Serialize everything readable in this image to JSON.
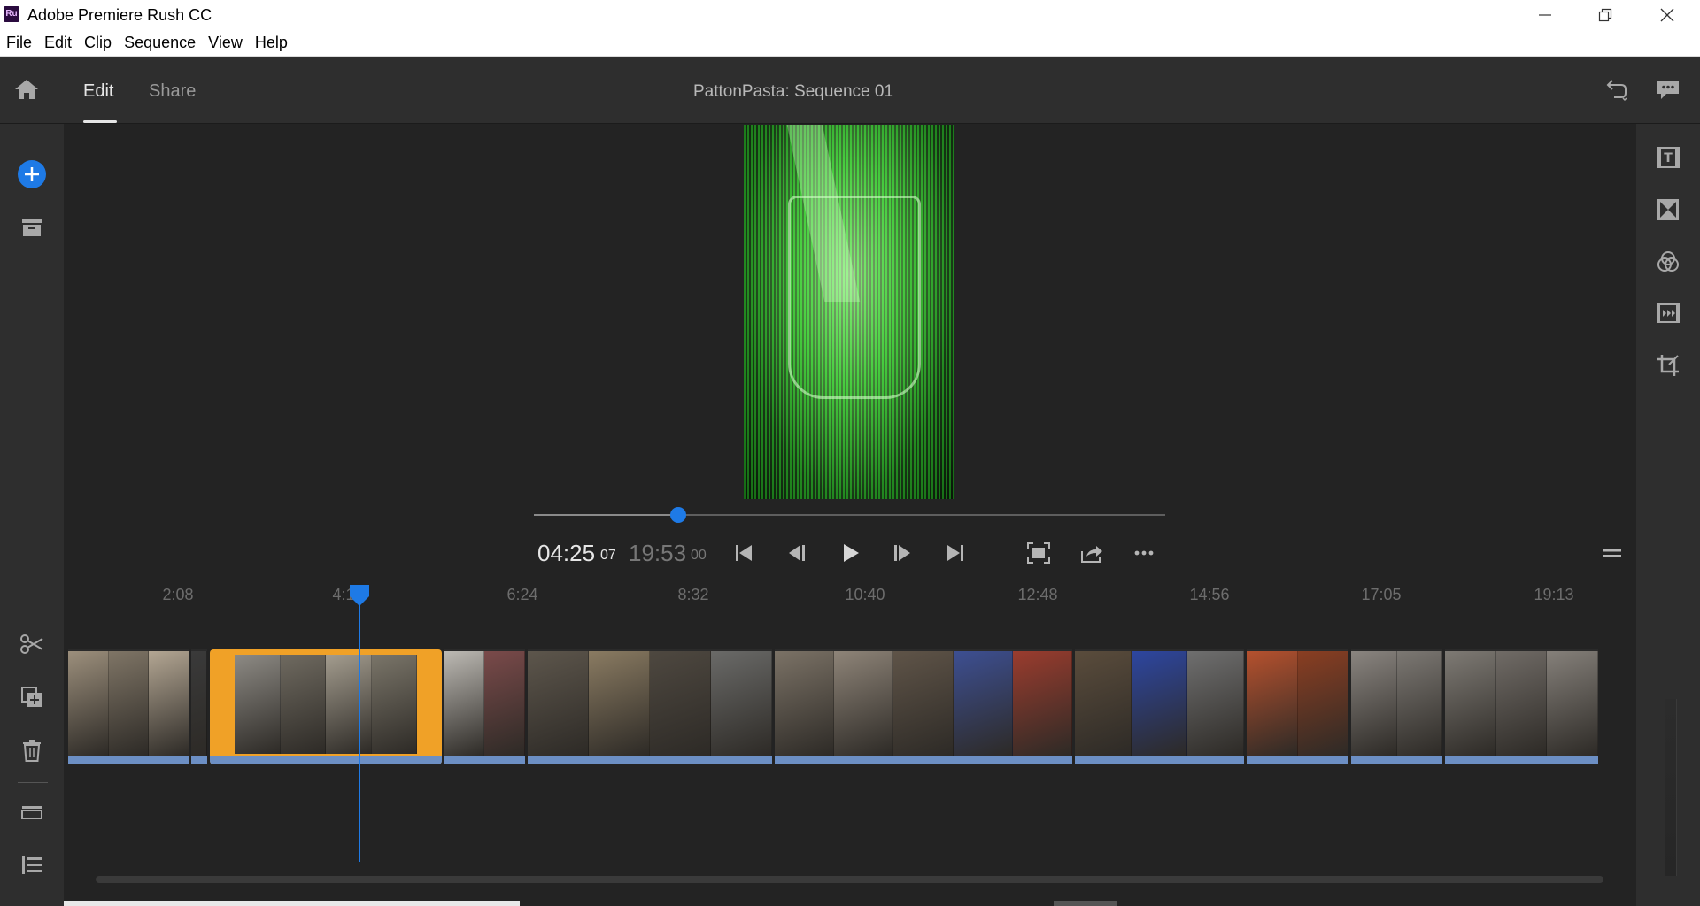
{
  "window": {
    "title": "Adobe Premiere Rush CC",
    "logo_text": "Ru"
  },
  "menu": [
    "File",
    "Edit",
    "Clip",
    "Sequence",
    "View",
    "Help"
  ],
  "appbar": {
    "tabs": [
      "Edit",
      "Share"
    ],
    "active_tab": "Edit",
    "sequence_title": "PattonPasta: Sequence 01"
  },
  "player": {
    "current_time": "04:25",
    "current_frames": "07",
    "total_time": "19:53",
    "total_frames": "00",
    "position_fraction": 0.228
  },
  "ruler": {
    "ticks": [
      "2:08",
      "4:16",
      "6:24",
      "8:32",
      "10:40",
      "12:48",
      "14:56",
      "17:05",
      "19:13"
    ]
  },
  "timeline": {
    "clips": [
      {
        "colors": [
          "#9c8f7c",
          "#7f7566",
          "#b3a693"
        ],
        "selected": false
      },
      {
        "colors": [
          "#3a3a3a"
        ],
        "selected": false
      },
      {
        "colors": [
          "#8d8a84",
          "#6f6a60",
          "#a39c8e",
          "#7a7569"
        ],
        "selected": true
      },
      {
        "colors": [
          "#bdbab4",
          "#7a4a4a"
        ],
        "selected": false
      },
      {
        "colors": [
          "#5d564c",
          "#8a7b62",
          "#4e4840",
          "#6a6a68"
        ],
        "selected": false
      },
      {
        "colors": [
          "#7b7266",
          "#8e8478",
          "#5f5448",
          "#3d4f92",
          "#9a3c2e"
        ],
        "selected": false
      },
      {
        "colors": [
          "#5a4c3c",
          "#2d46a0",
          "#6f6f6f"
        ],
        "selected": false
      },
      {
        "colors": [
          "#b5512e",
          "#8a3e22"
        ],
        "selected": false
      },
      {
        "colors": [
          "#8a8580",
          "#7c7873"
        ],
        "selected": false
      },
      {
        "colors": [
          "#7e7a74",
          "#706b66",
          "#85807a"
        ],
        "selected": false
      }
    ]
  }
}
